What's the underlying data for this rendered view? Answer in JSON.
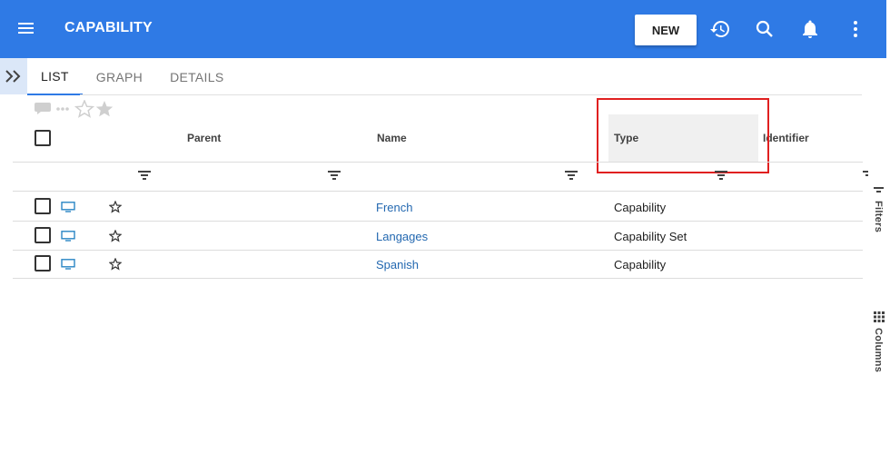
{
  "appbar": {
    "title": "CAPABILITY",
    "new_label": "NEW",
    "color": "#2f7ae5"
  },
  "icons": {
    "menu": "hamburger-menu-icon",
    "history": "history-icon",
    "search": "search-icon",
    "notifications": "bell-icon",
    "more": "more-vert-icon",
    "expand": "double-chevron-right-icon",
    "comment": "comment-icon",
    "dots": "more-horiz-icon",
    "favorite": "star-outline-icon",
    "favorites": "star-filled-icon",
    "filter": "filter-lines-icon",
    "monitor": "monitor-icon",
    "columns": "grid-dots-icon"
  },
  "tabs": [
    {
      "label": "LIST",
      "active": true
    },
    {
      "label": "GRAPH",
      "active": false
    },
    {
      "label": "DETAILS",
      "active": false
    }
  ],
  "table": {
    "columns": [
      "Parent",
      "Name",
      "Type",
      "Identifier"
    ],
    "rows": [
      {
        "parent": "",
        "name": "French",
        "type": "Capability",
        "identifier": ""
      },
      {
        "parent": "",
        "name": "Langages",
        "type": "Capability Set",
        "identifier": ""
      },
      {
        "parent": "",
        "name": "Spanish",
        "type": "Capability",
        "identifier": ""
      }
    ]
  },
  "side_rail": {
    "filters_label": "Filters",
    "columns_label": "Columns"
  },
  "highlight_color": "#e02020"
}
